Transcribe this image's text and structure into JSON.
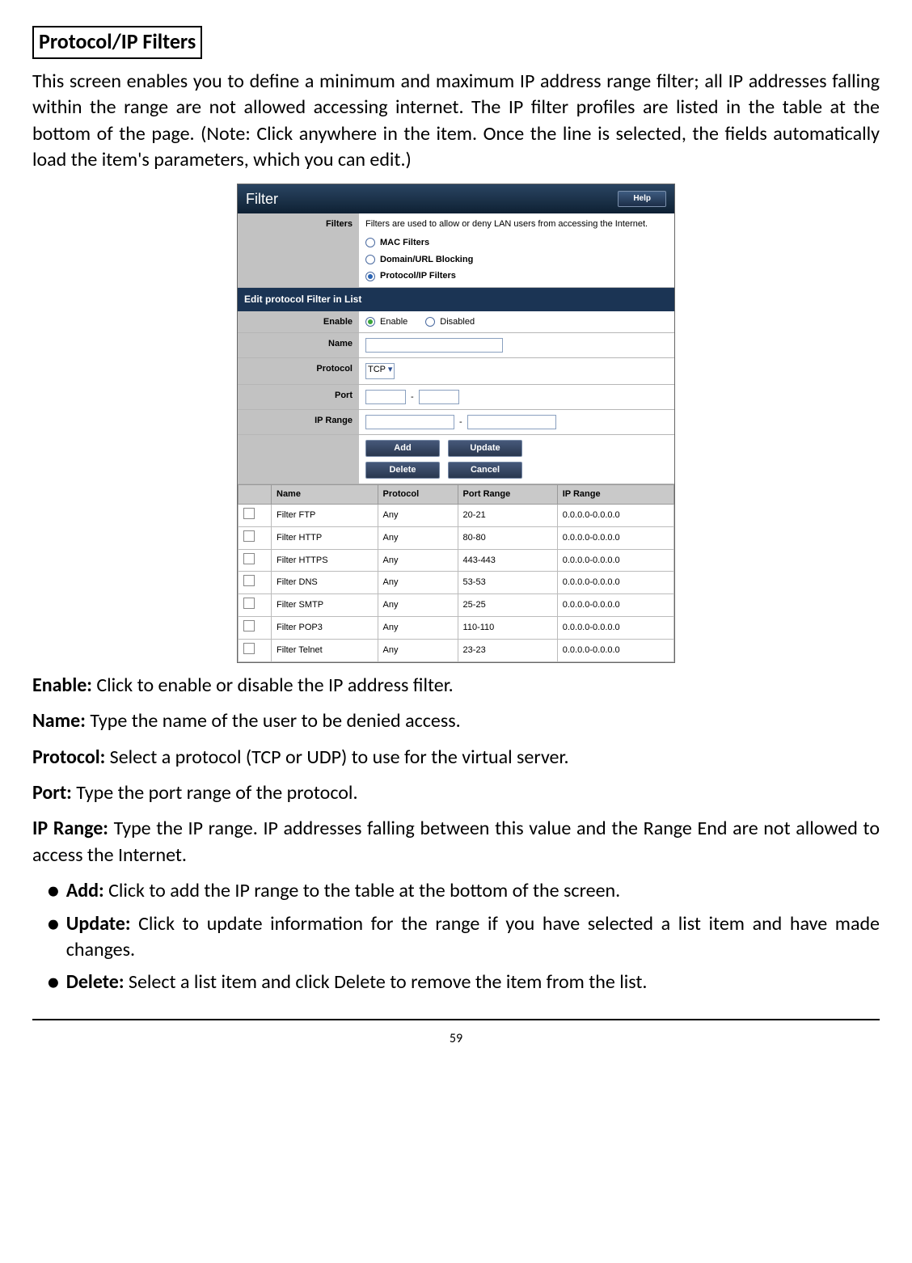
{
  "heading": "Protocol/IP Filters",
  "intro": "This screen enables you to define a minimum and maximum IP address range filter; all IP addresses falling within the range are not allowed accessing internet. The IP filter profiles are listed in the table at the bottom of the page. (Note: Click anywhere in the item. Once the line is selected, the fields automatically load the item's parameters, which you can edit.)",
  "defs": {
    "enable_label": "Enable:",
    "enable_text": " Click to enable or disable the IP address filter.",
    "name_label": "Name:",
    "name_text": " Type the name of the user to be denied access.",
    "protocol_label": "Protocol:",
    "protocol_text": " Select a protocol (TCP or UDP) to use for the virtual server.",
    "port_label": "Port:",
    "port_text": " Type the port range of the protocol.",
    "iprange_label": "IP Range:",
    "iprange_text": " Type the IP range. IP addresses falling between this value and the Range End are not allowed to access the Internet."
  },
  "bullets": {
    "add_label": "Add:",
    "add_text": " Click to add the IP range to the table at the bottom of the screen.",
    "update_label": "Update:",
    "update_text": " Click to update information for the range if you have selected a list item and have made changes.",
    "delete_label": "Delete:",
    "delete_text": " Select a list item and click Delete to remove the item from the list."
  },
  "page_number": "59",
  "shot": {
    "title": "Filter",
    "help": "Help",
    "filters_label": "Filters",
    "filters_desc": "Filters are used to allow or deny LAN users from accessing the Internet.",
    "radio_mac": "MAC Filters",
    "radio_domain": "Domain/URL Blocking",
    "radio_proto": "Protocol/IP Filters",
    "section_edit": "Edit protocol Filter in List",
    "row_enable": "Enable",
    "opt_enable": "Enable",
    "opt_disabled": "Disabled",
    "row_name": "Name",
    "row_protocol": "Protocol",
    "sel_tcp": "TCP",
    "row_port": "Port",
    "row_iprange": "IP Range",
    "btn_add": "Add",
    "btn_update": "Update",
    "btn_delete": "Delete",
    "btn_cancel": "Cancel",
    "cols": {
      "name": "Name",
      "protocol": "Protocol",
      "portrange": "Port Range",
      "iprange": "IP Range"
    },
    "rows": [
      {
        "name": "Filter FTP",
        "protocol": "Any",
        "port": "20-21",
        "ip": "0.0.0.0-0.0.0.0"
      },
      {
        "name": "Filter HTTP",
        "protocol": "Any",
        "port": "80-80",
        "ip": "0.0.0.0-0.0.0.0"
      },
      {
        "name": "Filter HTTPS",
        "protocol": "Any",
        "port": "443-443",
        "ip": "0.0.0.0-0.0.0.0"
      },
      {
        "name": "Filter DNS",
        "protocol": "Any",
        "port": "53-53",
        "ip": "0.0.0.0-0.0.0.0"
      },
      {
        "name": "Filter SMTP",
        "protocol": "Any",
        "port": "25-25",
        "ip": "0.0.0.0-0.0.0.0"
      },
      {
        "name": "Filter POP3",
        "protocol": "Any",
        "port": "110-110",
        "ip": "0.0.0.0-0.0.0.0"
      },
      {
        "name": "Filter Telnet",
        "protocol": "Any",
        "port": "23-23",
        "ip": "0.0.0.0-0.0.0.0"
      }
    ]
  }
}
